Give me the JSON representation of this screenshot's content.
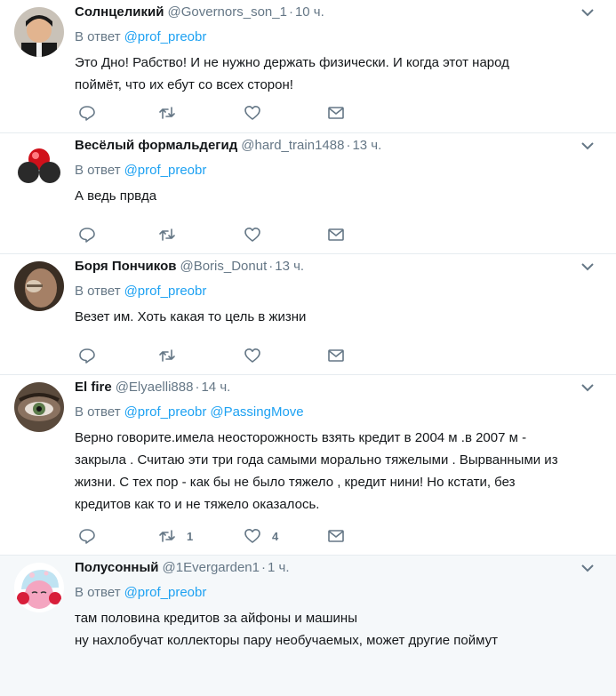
{
  "tweets": [
    {
      "name": "Солнцеликий",
      "handle": "@Governors_son_1",
      "time": "10 ч.",
      "reply_prefix": "В ответ",
      "mentions": [
        "@prof_preobr"
      ],
      "text_lines": [
        "Это Дно! Рабство! И не нужно держать физически. И когда этот народ",
        "поймёт, что их ебут со всех сторон!"
      ],
      "retweets": "",
      "likes": ""
    },
    {
      "name": "Весёлый формальдегид",
      "handle": "@hard_train1488",
      "time": "13 ч.",
      "reply_prefix": "В ответ",
      "mentions": [
        "@prof_preobr"
      ],
      "text_lines": [
        "А ведь првда"
      ],
      "retweets": "",
      "likes": ""
    },
    {
      "name": "Боря Пончиков",
      "handle": "@Boris_Donut",
      "time": "13 ч.",
      "reply_prefix": "В ответ",
      "mentions": [
        "@prof_preobr"
      ],
      "text_lines": [
        "Везет им. Хоть какая то цель в жизни"
      ],
      "retweets": "",
      "likes": ""
    },
    {
      "name": "El fire",
      "handle": "@Elyaelli888",
      "time": "14 ч.",
      "reply_prefix": "В ответ",
      "mentions": [
        "@prof_preobr",
        "@PassingMove"
      ],
      "text_lines": [
        "Верно говорите.имела неосторожность взять кредит в 2004 м .в 2007 м -",
        "закрыла . Считаю эти три года самыми морально тяжелыми . Вырванными из",
        "жизни. С тех пор - как бы не было тяжело , кредит нини! Но кстати, без",
        "кредитов как то и не тяжело оказалось."
      ],
      "retweets": "1",
      "likes": "4"
    },
    {
      "name": "Полусонный",
      "handle": "@1Evergarden1",
      "time": "1 ч.",
      "reply_prefix": "В ответ",
      "mentions": [
        "@prof_preobr"
      ],
      "text_lines": [
        "там половина кредитов за айфоны и машины",
        "ну нахлобучат коллекторы пару необучаемых, может другие поймут"
      ],
      "retweets": "",
      "likes": ""
    }
  ],
  "icons": {
    "reply": "reply-icon",
    "retweet": "retweet-icon",
    "like": "heart-icon",
    "dm": "envelope-icon",
    "caret": "chevron-down-icon"
  },
  "colors": {
    "link": "#1da1f2",
    "secondary": "#657786",
    "text": "#14171a",
    "divider": "#e6ecf0",
    "highlight_bg": "#f5f8fa"
  }
}
